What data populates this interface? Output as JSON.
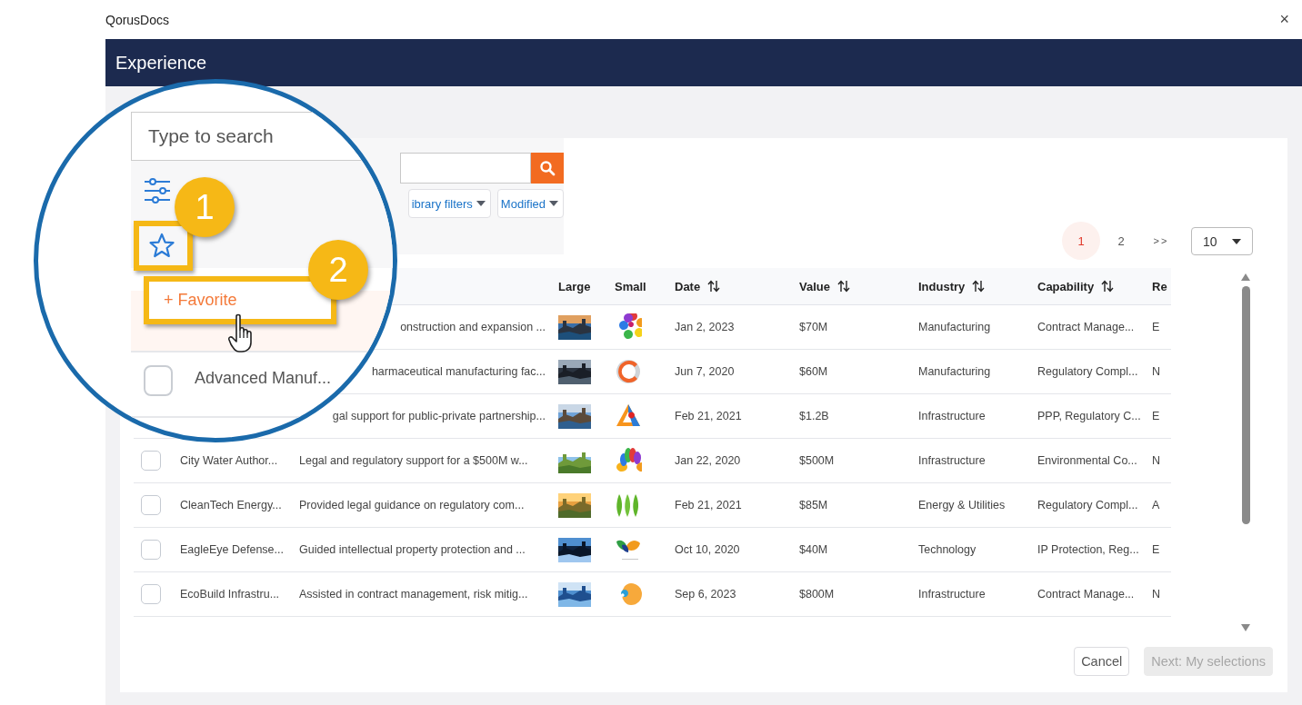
{
  "window": {
    "title": "QorusDocs",
    "close": "×"
  },
  "header": {
    "title": "Experience"
  },
  "filters": [
    {
      "label": "ibrary filters"
    },
    {
      "label": "Modified"
    }
  ],
  "pagination": {
    "pages": [
      {
        "label": "1",
        "selected": true
      },
      {
        "label": "2",
        "selected": false
      }
    ],
    "next": ">>",
    "page_size": "10"
  },
  "table": {
    "columns": [
      {
        "label": "Large",
        "sortable": false
      },
      {
        "label": "Small",
        "sortable": false
      },
      {
        "label": "Date",
        "sortable": true
      },
      {
        "label": "Value",
        "sortable": true
      },
      {
        "label": "Industry",
        "sortable": true
      },
      {
        "label": "Capability",
        "sortable": true
      },
      {
        "label": "Re",
        "sortable": false
      }
    ],
    "rows": [
      {
        "kind": "covered",
        "description": "onstruction and expansion ...",
        "date": "Jan 2, 2023",
        "value": "$70M",
        "industry": "Manufacturing",
        "capability": "Contract Manage...",
        "column_10": "E"
      },
      {
        "kind": "covered",
        "description": "harmaceutical manufacturing fac...",
        "date": "Jun 7, 2020",
        "value": "$60M",
        "industry": "Manufacturing",
        "capability": "Regulatory Compl...",
        "column_10": "N"
      },
      {
        "kind": "covered",
        "description": "gal support for public-private partnership...",
        "date": "Feb 21, 2021",
        "value": "$1.2B",
        "industry": "Infrastructure",
        "capability": "PPP, Regulatory C...",
        "column_10": "E"
      },
      {
        "kind": "full",
        "checked": false,
        "name": "City Water Author...",
        "description": "Legal and regulatory support for a $500M w...",
        "date": "Jan 22, 2020",
        "value": "$500M",
        "industry": "Infrastructure",
        "capability": "Environmental Co...",
        "column_10": "N"
      },
      {
        "kind": "full",
        "checked": false,
        "name": "CleanTech Energy...",
        "description": "Provided legal guidance on regulatory com...",
        "date": "Feb 21, 2021",
        "value": "$85M",
        "industry": "Energy & Utilities",
        "capability": "Regulatory Compl...",
        "column_10": "A"
      },
      {
        "kind": "full",
        "checked": false,
        "name": "EagleEye Defense...",
        "description": "Guided intellectual property protection and ...",
        "date": "Oct 10, 2020",
        "value": "$40M",
        "industry": "Technology",
        "capability": "IP Protection, Reg...",
        "column_10": "E"
      },
      {
        "kind": "full",
        "checked": false,
        "name": "EcoBuild Infrastru...",
        "description": "Assisted in contract management, risk mitig...",
        "date": "Sep 6, 2023",
        "value": "$800M",
        "industry": "Infrastructure",
        "capability": "Contract Manage...",
        "column_10": "N"
      }
    ]
  },
  "magnifier": {
    "search_placeholder": "Type to search",
    "favorite_button": "+ Favorite",
    "callouts": [
      "1",
      "2"
    ],
    "row": {
      "name": "Advanced Manuf...",
      "checked": false
    }
  },
  "footer": {
    "buttons": [
      {
        "label": "Cancel",
        "disabled": false
      },
      {
        "label": "Next: My selections",
        "disabled": true
      }
    ]
  }
}
